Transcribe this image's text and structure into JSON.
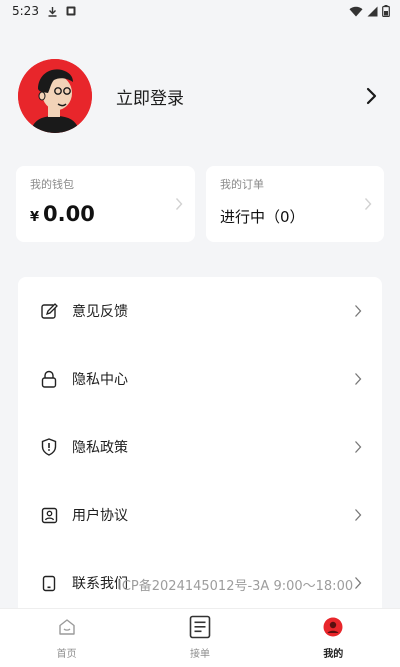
{
  "status_bar": {
    "time": "5:23"
  },
  "profile": {
    "login_label": "立即登录"
  },
  "wallet": {
    "label": "我的钱包",
    "currency": "¥",
    "amount": "0.00"
  },
  "orders": {
    "label": "我的订单",
    "status": "进行中（0）"
  },
  "menu": {
    "items": [
      {
        "label": "意见反馈",
        "icon": "feedback-icon"
      },
      {
        "label": "隐私中心",
        "icon": "lock-icon"
      },
      {
        "label": "隐私政策",
        "icon": "shield-icon"
      },
      {
        "label": "用户协议",
        "icon": "agreement-icon"
      },
      {
        "label": "联系我们",
        "icon": "phone-icon"
      }
    ]
  },
  "footer": {
    "icp_text": "ICP备2024145012号-3A  9:00～18:00"
  },
  "tabs": [
    {
      "label": "首页",
      "icon": "home-icon",
      "active": false
    },
    {
      "label": "接单",
      "icon": "order-icon",
      "active": false
    },
    {
      "label": "我的",
      "icon": "profile-icon",
      "active": true
    }
  ],
  "colors": {
    "accent": "#e8262b",
    "background": "#f4f5f7"
  }
}
